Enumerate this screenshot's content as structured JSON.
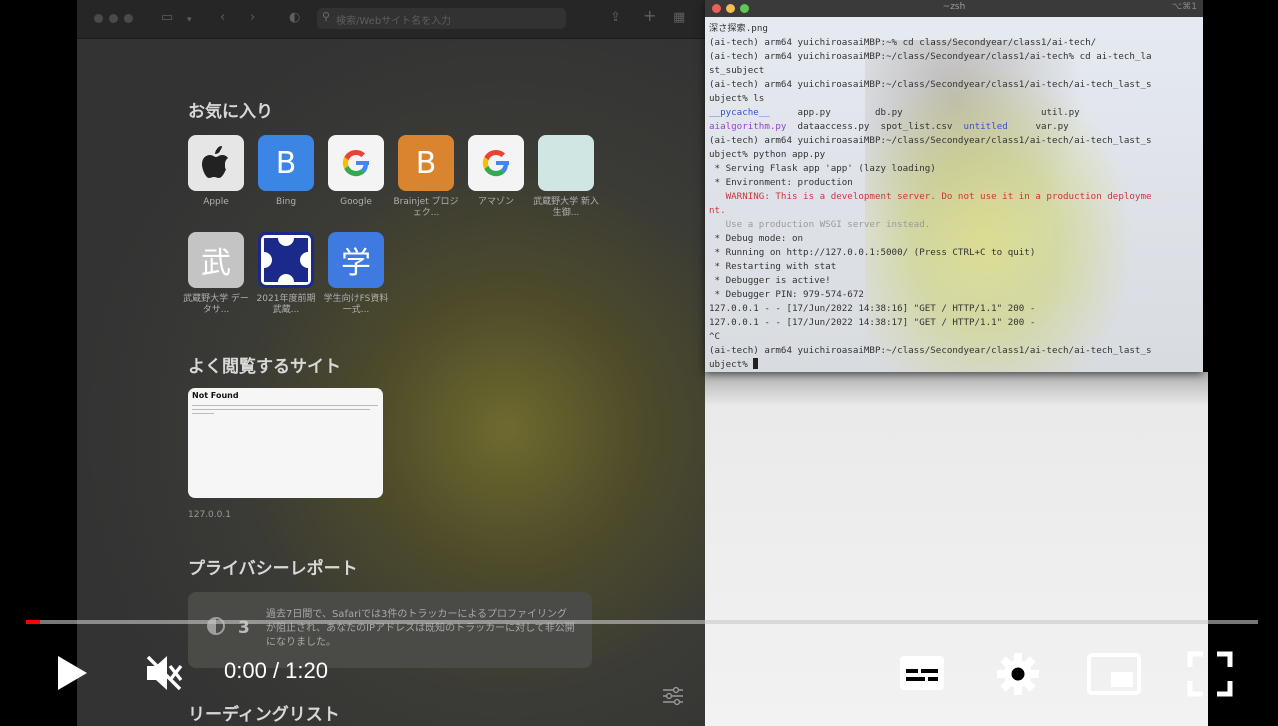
{
  "safari": {
    "search_placeholder": "検索/Webサイト名を入力",
    "favorites_title": "お気に入り",
    "favorites": [
      {
        "label": "Apple",
        "tile_text": "",
        "icon": "apple-icon",
        "bg": "#e6e6e6",
        "fg": "#333333"
      },
      {
        "label": "Bing",
        "tile_text": "B",
        "icon": "",
        "bg": "#3b86e4",
        "fg": "#ffffff"
      },
      {
        "label": "Google",
        "tile_text": "G",
        "icon": "google-g-icon",
        "bg": "#f4f4f4",
        "fg": "#4285f4"
      },
      {
        "label": "Brainjet プロジェク...",
        "tile_text": "B",
        "icon": "",
        "bg": "#d9852f",
        "fg": "#ffffff"
      },
      {
        "label": "アマゾン",
        "tile_text": "G",
        "icon": "google-g-icon",
        "bg": "#f4f4f4",
        "fg": "#4285f4"
      },
      {
        "label": "武蔵野大学 新入生御...",
        "tile_text": "",
        "icon": "",
        "bg": "#cfe6e3",
        "fg": "#ffffff"
      },
      {
        "label": "武蔵野大学 データサ...",
        "tile_text": "武",
        "icon": "",
        "bg": "#c4c4c4",
        "fg": "#ffffff"
      },
      {
        "label": "2021年度前期 武蔵...",
        "tile_text": "",
        "icon": "musashino-logo-icon",
        "bg": "#ffffff",
        "fg": "#1b2a8a"
      },
      {
        "label": "学生向けFS資料一式...",
        "tile_text": "学",
        "icon": "",
        "bg": "#3e7ae0",
        "fg": "#ffffff"
      }
    ],
    "frequent_title": "よく閲覧するサイト",
    "frequent_preview_heading": "Not Found",
    "frequent_url": "127.0.0.1",
    "privacy_title": "プライバシーレポート",
    "privacy_count": "3",
    "privacy_text": "過去7日間で、Safariでは3件のトラッカーによるプロファイリングが阻止され、あなたのIPアドレスは既知のトラッカーに対して非公開になりました。",
    "reading_title": "リーディングリスト"
  },
  "terminal": {
    "title": "~zsh",
    "title_right": "⌥⌘1",
    "lines": [
      {
        "t": "深さ探索.png",
        "c": ""
      },
      {
        "t": "(ai-tech) arm64 yuichiroasaiMBP:~% cd class/Secondyear/class1/ai-tech/",
        "c": ""
      },
      {
        "t": "(ai-tech) arm64 yuichiroasaiMBP:~/class/Secondyear/class1/ai-tech% cd ai-tech_la",
        "c": ""
      },
      {
        "t": "st_subject",
        "c": ""
      },
      {
        "t": "(ai-tech) arm64 yuichiroasaiMBP:~/class/Secondyear/class1/ai-tech/ai-tech_last_s",
        "c": ""
      },
      {
        "t": "ubject% ls",
        "c": ""
      },
      {
        "t": "__pycache__     app.py        db.py                         util.py",
        "c": "ls1"
      },
      {
        "t": "aialgorithm.py  dataaccess.py  spot_list.csv  untitled     var.py",
        "c": "ls2"
      },
      {
        "t": "(ai-tech) arm64 yuichiroasaiMBP:~/class/Secondyear/class1/ai-tech/ai-tech_last_s",
        "c": ""
      },
      {
        "t": "ubject% python app.py",
        "c": ""
      },
      {
        "t": " * Serving Flask app 'app' (lazy loading)",
        "c": ""
      },
      {
        "t": " * Environment: production",
        "c": ""
      },
      {
        "t": "   WARNING: This is a development server. Do not use it in a production deployme",
        "c": "red"
      },
      {
        "t": "nt.",
        "c": "red"
      },
      {
        "t": "   Use a production WSGI server instead.",
        "c": "grey"
      },
      {
        "t": " * Debug mode: on",
        "c": ""
      },
      {
        "t": " * Running on http://127.0.0.1:5000/ (Press CTRL+C to quit)",
        "c": ""
      },
      {
        "t": " * Restarting with stat",
        "c": ""
      },
      {
        "t": " * Debugger is active!",
        "c": ""
      },
      {
        "t": " * Debugger PIN: 979-574-672",
        "c": ""
      },
      {
        "t": "127.0.0.1 - - [17/Jun/2022 14:38:16] \"GET / HTTP/1.1\" 200 -",
        "c": ""
      },
      {
        "t": "127.0.0.1 - - [17/Jun/2022 14:38:17] \"GET / HTTP/1.1\" 200 -",
        "c": ""
      },
      {
        "t": "^C",
        "c": ""
      },
      {
        "t": "(ai-tech) arm64 yuichiroasaiMBP:~/class/Secondyear/class1/ai-tech/ai-tech_last_s",
        "c": ""
      },
      {
        "t": "ubject% ",
        "c": "prompt"
      }
    ]
  },
  "player": {
    "current_time": "0:00",
    "separator": " / ",
    "duration": "1:20",
    "progress_fraction": 0.011,
    "accent_color": "#ff0000"
  }
}
